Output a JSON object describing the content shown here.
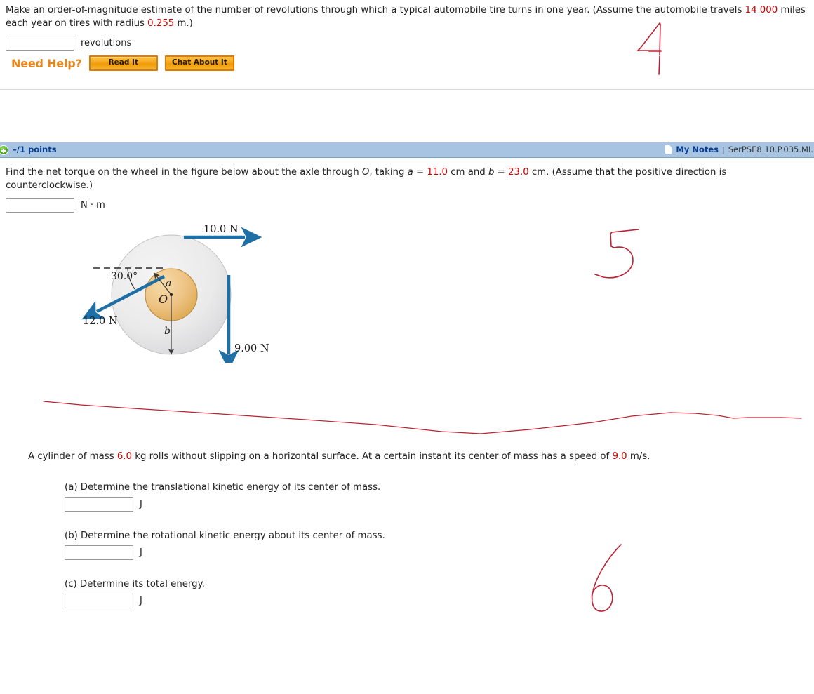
{
  "q1": {
    "text_before_1": "Make an order-of-magnitude estimate of the number of revolutions through which a typical automobile tire turns in one year. (Assume the automobile travels ",
    "miles_value": "14 000",
    "text_mid": " miles each year on tires with radius ",
    "radius_value": "0.255",
    "text_after": " m.)",
    "answer_value": "",
    "answer_unit": "revolutions",
    "need_help_label": "Need Help?",
    "read_it_label": "Read It",
    "chat_label": "Chat About It"
  },
  "points_bar": {
    "plus_icon": "plus-circle-icon",
    "points_label": "–/1 points",
    "note_icon": "note-page-icon",
    "my_notes_label": "My Notes",
    "separator": "|",
    "question_code": "SerPSE8 10.P.035.MI."
  },
  "q2": {
    "text_1": "Find the net torque on the wheel in the figure below about the axle through ",
    "axle_symbol": "O",
    "text_2": ", taking ",
    "a_symbol": "a",
    "eq1": " = ",
    "a_value": "11.0",
    "text_3": " cm and ",
    "b_symbol": "b",
    "eq2": " = ",
    "b_value": "23.0",
    "text_4": " cm. (Assume that the positive direction is counterclockwise.)",
    "answer_value": "",
    "answer_unit": "N · m"
  },
  "figure": {
    "force_top_label": "10.0 N",
    "force_left_label": "12.0 N",
    "force_bottom_label": "9.00 N",
    "angle_label": "30.0°",
    "radius_a_label": "a",
    "radius_b_label": "b",
    "center_label": "O",
    "outer_disk_color": "#e9e9ea",
    "inner_disk_color": "#e8b968",
    "arrow_color": "#1d6fa5"
  },
  "q3": {
    "text_1": "A cylinder of mass ",
    "mass_value": "6.0",
    "text_2": " kg rolls without slipping on a horizontal surface. At a certain instant its center of mass has a speed of ",
    "speed_value": "9.0",
    "text_3": " m/s.",
    "parts": [
      {
        "label": "(a) Determine the translational kinetic energy of its center of mass.",
        "value": "",
        "unit": "J"
      },
      {
        "label": "(b) Determine the rotational kinetic energy about its center of mass.",
        "value": "",
        "unit": "J"
      },
      {
        "label": "(c) Determine its total energy.",
        "value": "",
        "unit": "J"
      }
    ]
  },
  "annotations": {
    "ink_color": "#bb2233",
    "mark_4": "4",
    "mark_5": "5",
    "mark_6": "6",
    "separator_line": "hand-drawn horizontal separator line"
  }
}
